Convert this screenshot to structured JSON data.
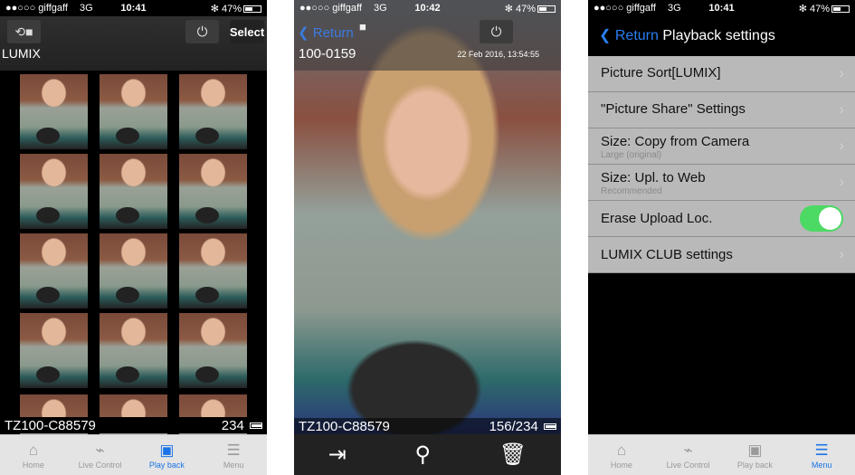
{
  "status": {
    "carrier": "●●○○○ giffgaff",
    "network": "3G",
    "battery": "47%",
    "times": [
      "10:41",
      "10:42",
      "10:41"
    ]
  },
  "screen1": {
    "select": "Select",
    "title": "LUMIX",
    "camera": "TZ100-C88579",
    "count": "234"
  },
  "screen2": {
    "back": "Return",
    "file": "100-0159",
    "date": "22 Feb 2016, 13:54:55",
    "camera": "TZ100-C88579",
    "position": "156/234"
  },
  "screen3": {
    "back": "Return",
    "title": "Playback settings",
    "items": [
      {
        "label": "Picture Sort[LUMIX]"
      },
      {
        "label": "\"Picture Share\" Settings"
      },
      {
        "label": "Size: Copy from Camera",
        "sub": "Large (original)"
      },
      {
        "label": "Size: Upl. to Web",
        "sub": "Recommended"
      },
      {
        "label": "Erase Upload Loc.",
        "toggle": true
      },
      {
        "label": "LUMIX CLUB settings"
      }
    ]
  },
  "tabs": [
    {
      "label": "Home",
      "icon": "home-icon"
    },
    {
      "label": "Live Control",
      "icon": "remote-icon"
    },
    {
      "label": "Play back",
      "icon": "play-icon"
    },
    {
      "label": "Menu",
      "icon": "menu-icon"
    }
  ],
  "active_tab": [
    "Play back",
    "Menu"
  ],
  "colors": {
    "accent": "#1a73e8",
    "toggle_on": "#4cd964"
  }
}
